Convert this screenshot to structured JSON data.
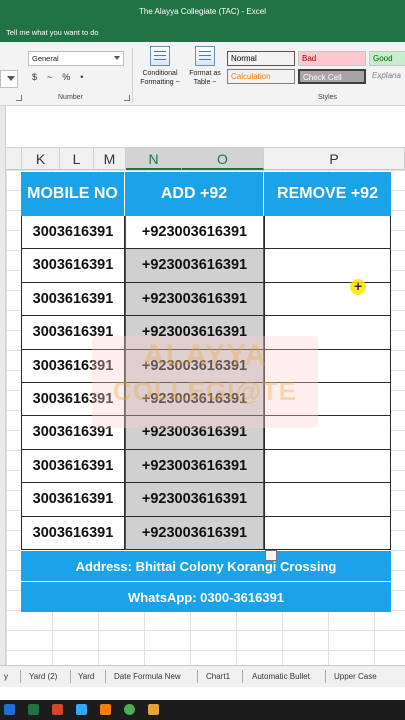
{
  "window": {
    "title": "The Alayya Collegiate (TAC)  -  Excel",
    "tell_me": "Tell me what you want to do"
  },
  "ribbon": {
    "number_format": "General",
    "number_symbols": [
      "$",
      "~",
      "%",
      "•"
    ],
    "number_group_label": "Number",
    "conditional_formatting": "Conditional Formatting ~",
    "format_as_table": "Format as Table ~",
    "styles_label": "Styles",
    "styles": [
      {
        "label": "Normal",
        "bg": "#ffffff",
        "color": "#000000"
      },
      {
        "label": "Bad",
        "bg": "#ffc7ce",
        "color": "#9c0006"
      },
      {
        "label": "Good",
        "bg": "#c6efce",
        "color": "#006100"
      },
      {
        "label": "Calculation",
        "bg": "#f2f2f2",
        "color": "#fa7d00"
      },
      {
        "label": "Check Cell",
        "bg": "#a5a5a5",
        "color": "#ffffff"
      },
      {
        "label": "Explana",
        "bg": "#ffffff",
        "color": "#7f7f7f"
      }
    ]
  },
  "columns": [
    "K",
    "L",
    "M",
    "N",
    "O",
    "P"
  ],
  "table": {
    "headers": [
      "MOBILE NO",
      "ADD +92",
      "REMOVE +92"
    ],
    "rows": [
      [
        "3003616391",
        "+923003616391",
        ""
      ],
      [
        "3003616391",
        "+923003616391",
        ""
      ],
      [
        "3003616391",
        "+923003616391",
        ""
      ],
      [
        "3003616391",
        "+923003616391",
        ""
      ],
      [
        "3003616391",
        "+923003616391",
        ""
      ],
      [
        "3003616391",
        "+923003616391",
        ""
      ],
      [
        "3003616391",
        "+923003616391",
        ""
      ],
      [
        "3003616391",
        "+923003616391",
        ""
      ],
      [
        "3003616391",
        "+923003616391",
        ""
      ],
      [
        "3003616391",
        "+923003616391",
        ""
      ]
    ],
    "address": "Address: Bhittai Colony Korangi Crossing",
    "whatsapp": "WhatsApp: 0300-3616391"
  },
  "watermark": {
    "line1": "ALAYYA",
    "line2": "COLLEGI@TE"
  },
  "sheet_tabs": [
    "y",
    "Yard (2)",
    "Yard",
    "Date Formula New",
    "Chart1",
    "Automatic Bullet",
    "Upper Case"
  ],
  "colors": {
    "excel_green": "#217346",
    "header_blue": "#1aa3e8",
    "selection_gray": "#d0d0d0"
  }
}
